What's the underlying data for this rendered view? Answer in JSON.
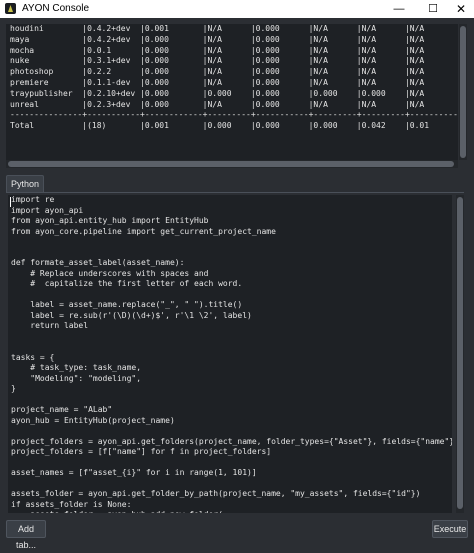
{
  "window": {
    "title": "AYON Console",
    "controls": {
      "minimize": "—",
      "maximize": "☐",
      "close": "✕"
    }
  },
  "output_lines": [
    "houdini        |0.4.2+dev  |0.001       |N/A      |0.000      |N/A      |N/A      |N/A",
    "maya           |0.4.2+dev  |0.000       |N/A      |0.000      |N/A      |N/A      |N/A",
    "mocha          |0.0.1      |0.000       |N/A      |0.000      |N/A      |N/A      |N/A",
    "nuke           |0.3.1+dev  |0.000       |N/A      |0.000      |N/A      |N/A      |N/A",
    "photoshop      |0.2.2      |0.000       |N/A      |0.000      |N/A      |N/A      |N/A",
    "premiere       |0.1.1-dev  |0.000       |N/A      |0.000      |N/A      |N/A      |N/A",
    "traypublisher  |0.2.10+dev |0.000       |0.000    |0.000      |0.000    |0.000    |N/A",
    "unreal         |0.2.3+dev  |0.000       |N/A      |0.000      |N/A      |N/A      |N/A",
    "---------------+-----------+------------+---------+-----------+---------+---------+----------",
    "Total          |(18)       |0.001       |0.000    |0.000      |0.000    |0.042    |0.01"
  ],
  "tabs": [
    {
      "label": "Python"
    }
  ],
  "editor_lines": [
    "import re",
    "import ayon_api",
    "from ayon_api.entity_hub import EntityHub",
    "from ayon_core.pipeline import get_current_project_name",
    "",
    "",
    "def formate_asset_label(asset_name):",
    "    # Replace underscores with spaces and",
    "    #  capitalize the first letter of each word.",
    "",
    "    label = asset_name.replace(\"_\", \" \").title()",
    "    label = re.sub(r'(\\D)(\\d+)$', r'\\1 \\2', label)",
    "    return label",
    "",
    "",
    "tasks = {",
    "    # task_type: task_name,",
    "    \"Modeling\": \"modeling\",",
    "}",
    "",
    "project_name = \"ALab\"",
    "ayon_hub = EntityHub(project_name)",
    "",
    "project_folders = ayon_api.get_folders(project_name, folder_types={\"Asset\"}, fields={\"name\"})",
    "project_folders = [f[\"name\"] for f in project_folders]",
    "",
    "asset_names = [f\"asset_{i}\" for i in range(1, 101)]",
    "",
    "assets_folder = ayon_api.get_folder_by_path(project_name, \"my_assets\", fields={\"id\"})",
    "if assets_folder is None:",
    "    assets_folder = ayon_hub.add_new_folder("
  ],
  "buttons": {
    "add_tab": "Add tab...",
    "execute": "Execute"
  }
}
